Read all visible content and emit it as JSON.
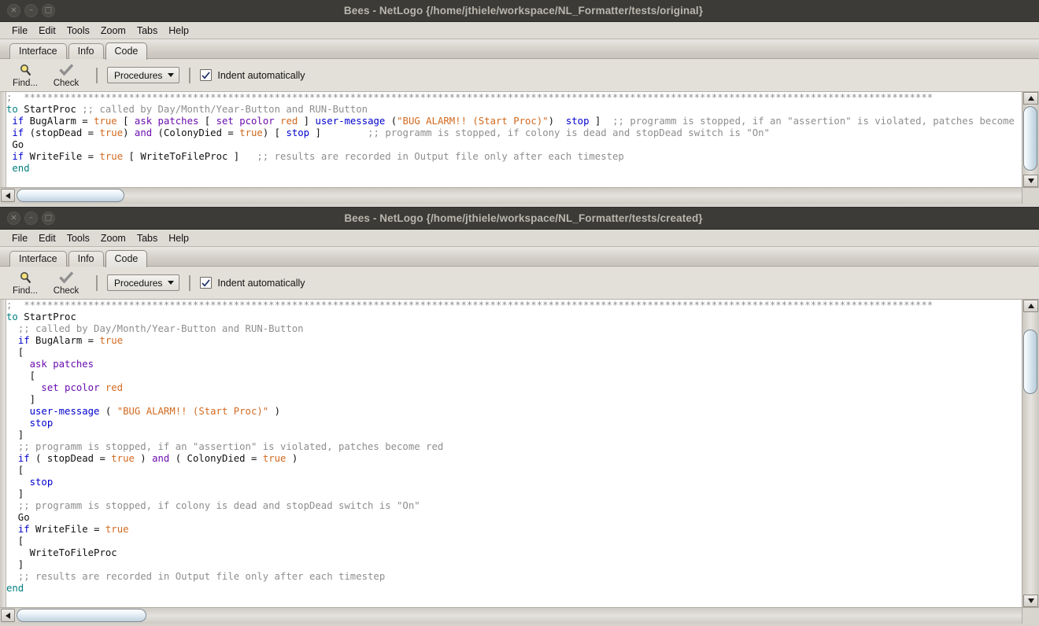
{
  "windows": [
    {
      "title": "Bees - NetLogo {/home/jthiele/workspace/NL_Formatter/tests/original}",
      "controls": {
        "close": "×",
        "minimize": "–",
        "maximize": "□"
      },
      "menu": [
        "File",
        "Edit",
        "Tools",
        "Zoom",
        "Tabs",
        "Help"
      ],
      "tabs": [
        {
          "label": "Interface",
          "active": false
        },
        {
          "label": "Info",
          "active": false
        },
        {
          "label": "Code",
          "active": true
        }
      ],
      "toolbar": {
        "find_label": "Find...",
        "check_label": "Check",
        "procedures_label": "Procedures",
        "indent_label": "Indent automatically",
        "indent_checked": true
      },
      "code_lines": [
        [
          {
            "t": ";  ",
            "c": "c-com"
          },
          {
            "t": "************************************************************************************************************************************************************",
            "c": "c-com"
          }
        ],
        [
          {
            "t": "to ",
            "c": "c-def"
          },
          {
            "t": "StartProc ",
            "c": "c-pln"
          },
          {
            "t": ";; called by Day/Month/Year-Button and RUN-Button",
            "c": "c-com"
          }
        ],
        [
          {
            "t": " ",
            "c": "c-pln"
          },
          {
            "t": "if ",
            "c": "c-kw"
          },
          {
            "t": "BugAlarm ",
            "c": "c-pln"
          },
          {
            "t": "= ",
            "c": "c-pln"
          },
          {
            "t": "true ",
            "c": "c-con"
          },
          {
            "t": "[ ",
            "c": "c-pln"
          },
          {
            "t": "ask ",
            "c": "c-cmd"
          },
          {
            "t": "patches ",
            "c": "c-cmd"
          },
          {
            "t": "[ ",
            "c": "c-pln"
          },
          {
            "t": "set ",
            "c": "c-cmd"
          },
          {
            "t": "pcolor ",
            "c": "c-cmd"
          },
          {
            "t": "red ",
            "c": "c-con"
          },
          {
            "t": "] ",
            "c": "c-pln"
          },
          {
            "t": "user-message ",
            "c": "c-kw"
          },
          {
            "t": "(",
            "c": "c-pln"
          },
          {
            "t": "\"BUG ALARM!! (Start Proc)\"",
            "c": "c-str"
          },
          {
            "t": ")  ",
            "c": "c-pln"
          },
          {
            "t": "stop ",
            "c": "c-kw"
          },
          {
            "t": "]  ",
            "c": "c-pln"
          },
          {
            "t": ";; programm is stopped, if an \"assertion\" is violated, patches become red",
            "c": "c-com"
          }
        ],
        [
          {
            "t": " ",
            "c": "c-pln"
          },
          {
            "t": "if ",
            "c": "c-kw"
          },
          {
            "t": "(stopDead ",
            "c": "c-pln"
          },
          {
            "t": "= ",
            "c": "c-pln"
          },
          {
            "t": "true",
            "c": "c-con"
          },
          {
            "t": ") ",
            "c": "c-pln"
          },
          {
            "t": "and ",
            "c": "c-cmd"
          },
          {
            "t": "(ColonyDied ",
            "c": "c-pln"
          },
          {
            "t": "= ",
            "c": "c-pln"
          },
          {
            "t": "true",
            "c": "c-con"
          },
          {
            "t": ") [ ",
            "c": "c-pln"
          },
          {
            "t": "stop ",
            "c": "c-kw"
          },
          {
            "t": "]        ",
            "c": "c-pln"
          },
          {
            "t": ";; programm is stopped, if colony is dead and stopDead switch is \"On\"",
            "c": "c-com"
          }
        ],
        [
          {
            "t": " Go",
            "c": "c-pln"
          }
        ],
        [
          {
            "t": " ",
            "c": "c-pln"
          },
          {
            "t": "if ",
            "c": "c-kw"
          },
          {
            "t": "WriteFile ",
            "c": "c-pln"
          },
          {
            "t": "= ",
            "c": "c-pln"
          },
          {
            "t": "true ",
            "c": "c-con"
          },
          {
            "t": "[ WriteToFileProc ]   ",
            "c": "c-pln"
          },
          {
            "t": ";; results are recorded in Output file only after each timestep",
            "c": "c-com"
          }
        ],
        [
          {
            "t": " end",
            "c": "c-def"
          }
        ]
      ]
    },
    {
      "title": "Bees - NetLogo {/home/jthiele/workspace/NL_Formatter/tests/created}",
      "controls": {
        "close": "×",
        "minimize": "–",
        "maximize": "□"
      },
      "menu": [
        "File",
        "Edit",
        "Tools",
        "Zoom",
        "Tabs",
        "Help"
      ],
      "tabs": [
        {
          "label": "Interface",
          "active": false
        },
        {
          "label": "Info",
          "active": false
        },
        {
          "label": "Code",
          "active": true
        }
      ],
      "toolbar": {
        "find_label": "Find...",
        "check_label": "Check",
        "procedures_label": "Procedures",
        "indent_label": "Indent automatically",
        "indent_checked": true
      },
      "code_lines": [
        [
          {
            "t": ";  ",
            "c": "c-com"
          },
          {
            "t": "************************************************************************************************************************************************************",
            "c": "c-com"
          }
        ],
        [
          {
            "t": "to ",
            "c": "c-def"
          },
          {
            "t": "StartProc",
            "c": "c-pln"
          }
        ],
        [
          {
            "t": "  ",
            "c": "c-pln"
          },
          {
            "t": ";; called by Day/Month/Year-Button and RUN-Button",
            "c": "c-com"
          }
        ],
        [
          {
            "t": "  ",
            "c": "c-pln"
          },
          {
            "t": "if ",
            "c": "c-kw"
          },
          {
            "t": "BugAlarm ",
            "c": "c-pln"
          },
          {
            "t": "= ",
            "c": "c-pln"
          },
          {
            "t": "true",
            "c": "c-con"
          }
        ],
        [
          {
            "t": "  [",
            "c": "c-pln"
          }
        ],
        [
          {
            "t": "    ",
            "c": "c-pln"
          },
          {
            "t": "ask ",
            "c": "c-cmd"
          },
          {
            "t": "patches",
            "c": "c-cmd"
          }
        ],
        [
          {
            "t": "    [",
            "c": "c-pln"
          }
        ],
        [
          {
            "t": "      ",
            "c": "c-pln"
          },
          {
            "t": "set ",
            "c": "c-cmd"
          },
          {
            "t": "pcolor ",
            "c": "c-cmd"
          },
          {
            "t": "red",
            "c": "c-con"
          }
        ],
        [
          {
            "t": "    ]",
            "c": "c-pln"
          }
        ],
        [
          {
            "t": "    ",
            "c": "c-pln"
          },
          {
            "t": "user-message ",
            "c": "c-kw"
          },
          {
            "t": "( ",
            "c": "c-pln"
          },
          {
            "t": "\"BUG ALARM!! (Start Proc)\"",
            "c": "c-str"
          },
          {
            "t": " )",
            "c": "c-pln"
          }
        ],
        [
          {
            "t": "    ",
            "c": "c-pln"
          },
          {
            "t": "stop",
            "c": "c-kw"
          }
        ],
        [
          {
            "t": "  ]",
            "c": "c-pln"
          }
        ],
        [
          {
            "t": "  ",
            "c": "c-pln"
          },
          {
            "t": ";; programm is stopped, if an \"assertion\" is violated, patches become red",
            "c": "c-com"
          }
        ],
        [
          {
            "t": "  ",
            "c": "c-pln"
          },
          {
            "t": "if ",
            "c": "c-kw"
          },
          {
            "t": "( stopDead ",
            "c": "c-pln"
          },
          {
            "t": "= ",
            "c": "c-pln"
          },
          {
            "t": "true",
            "c": "c-con"
          },
          {
            "t": " ) ",
            "c": "c-pln"
          },
          {
            "t": "and ",
            "c": "c-cmd"
          },
          {
            "t": "( ColonyDied ",
            "c": "c-pln"
          },
          {
            "t": "= ",
            "c": "c-pln"
          },
          {
            "t": "true",
            "c": "c-con"
          },
          {
            "t": " )",
            "c": "c-pln"
          }
        ],
        [
          {
            "t": "  [",
            "c": "c-pln"
          }
        ],
        [
          {
            "t": "    ",
            "c": "c-pln"
          },
          {
            "t": "stop",
            "c": "c-kw"
          }
        ],
        [
          {
            "t": "  ]",
            "c": "c-pln"
          }
        ],
        [
          {
            "t": "  ",
            "c": "c-pln"
          },
          {
            "t": ";; programm is stopped, if colony is dead and stopDead switch is \"On\"",
            "c": "c-com"
          }
        ],
        [
          {
            "t": "  Go",
            "c": "c-pln"
          }
        ],
        [
          {
            "t": "  ",
            "c": "c-pln"
          },
          {
            "t": "if ",
            "c": "c-kw"
          },
          {
            "t": "WriteFile ",
            "c": "c-pln"
          },
          {
            "t": "= ",
            "c": "c-pln"
          },
          {
            "t": "true",
            "c": "c-con"
          }
        ],
        [
          {
            "t": "  [",
            "c": "c-pln"
          }
        ],
        [
          {
            "t": "    WriteToFileProc",
            "c": "c-pln"
          }
        ],
        [
          {
            "t": "  ]",
            "c": "c-pln"
          }
        ],
        [
          {
            "t": "  ",
            "c": "c-pln"
          },
          {
            "t": ";; results are recorded in Output file only after each timestep",
            "c": "c-com"
          }
        ],
        [
          {
            "t": "end",
            "c": "c-def"
          }
        ]
      ]
    }
  ],
  "icons": {
    "find": "magnifier-icon",
    "check": "checkmark-icon",
    "checkbox_check": "check-glyph"
  },
  "colors": {
    "titlebar_bg": "#3c3b37",
    "titlebar_text": "#b9b6ae",
    "chrome_bg": "#e3e0da",
    "editor_bg": "#ffffff",
    "syntax_define": "#007f7f",
    "syntax_keyword": "#0000cd",
    "syntax_command": "#6a0dad",
    "syntax_constant": "#d2691e",
    "syntax_comment": "#8e8e8e",
    "scroll_thumb": "#c2d2de"
  }
}
